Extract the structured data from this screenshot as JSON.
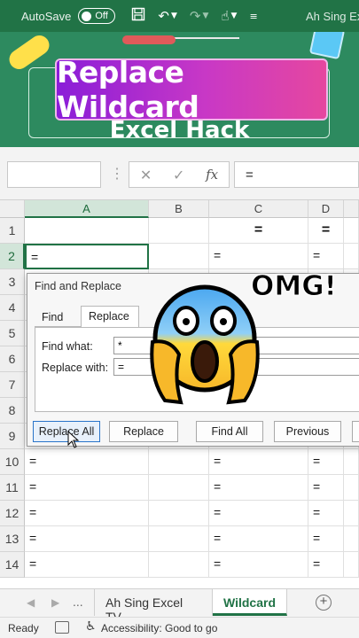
{
  "titlebar": {
    "autosave_label": "AutoSave",
    "toggle_state": "Off",
    "workbook_name": "Ah Sing Ex",
    "icons": [
      "save-icon",
      "undo-icon",
      "redo-icon",
      "touch-mode-icon",
      "customize-qat-icon"
    ]
  },
  "banner": {
    "title": "Replace Wildcard",
    "subtitle": "Excel Hack"
  },
  "formula_bar": {
    "name_box": "",
    "cancel_icon": "✕",
    "enter_icon": "✓",
    "fx_label": "fx",
    "value": "="
  },
  "grid": {
    "columns": [
      "A",
      "B",
      "C",
      "D"
    ],
    "selected_column": "A",
    "rows": [
      {
        "num": "1",
        "A": "",
        "B": "",
        "C": "=",
        "D": "="
      },
      {
        "num": "2",
        "A": "=",
        "B": "",
        "C": "=",
        "D": "="
      },
      {
        "num": "3"
      },
      {
        "num": "4"
      },
      {
        "num": "5"
      },
      {
        "num": "6"
      },
      {
        "num": "7"
      },
      {
        "num": "8"
      },
      {
        "num": "9"
      },
      {
        "num": "10",
        "A": "=",
        "B": "",
        "C": "=",
        "D": "="
      },
      {
        "num": "11",
        "A": "=",
        "B": "",
        "C": "=",
        "D": "="
      },
      {
        "num": "12",
        "A": "=",
        "B": "",
        "C": "=",
        "D": "="
      },
      {
        "num": "13",
        "A": "=",
        "B": "",
        "C": "=",
        "D": "="
      },
      {
        "num": "14",
        "A": "=",
        "B": "",
        "C": "=",
        "D": "="
      }
    ],
    "active_cell": "A2"
  },
  "dialog": {
    "title": "Find and Replace",
    "tab_find": "Find",
    "tab_replace": "Replace",
    "find_label": "Find what:",
    "find_value": "*",
    "replace_label": "Replace with:",
    "replace_value": "=",
    "btn_replace_all": "Replace All",
    "btn_replace": "Replace",
    "btn_find_all": "Find All",
    "btn_previous": "Previous"
  },
  "overlay": {
    "exclamation": "OMG!",
    "emoji": "screaming-face-emoji"
  },
  "sheets": {
    "tabs": [
      "Ah Sing Excel TV",
      "Wildcard"
    ],
    "active": "Wildcard",
    "more": "..."
  },
  "status": {
    "ready": "Ready",
    "accessibility": "Accessibility: Good to go"
  },
  "colors": {
    "excel_green": "#217346",
    "banner_green": "#2d8a5f",
    "title_gradient_start": "#8a1dd8",
    "title_gradient_end": "#e6479f"
  }
}
